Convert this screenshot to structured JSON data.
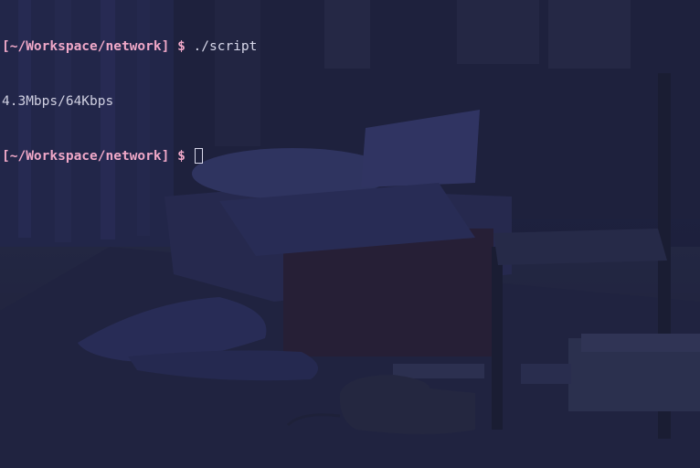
{
  "terminal": {
    "lines": [
      {
        "prompt": "[~/Workspace/network]",
        "symbol": "$",
        "command": "./script"
      },
      {
        "output": "4.3Mbps/64Kbps"
      },
      {
        "prompt": "[~/Workspace/network]",
        "symbol": "$",
        "command": ""
      }
    ]
  },
  "colors": {
    "background": "#1f2340",
    "prompt": "#f0a8c8",
    "text": "#d4d4e4"
  }
}
